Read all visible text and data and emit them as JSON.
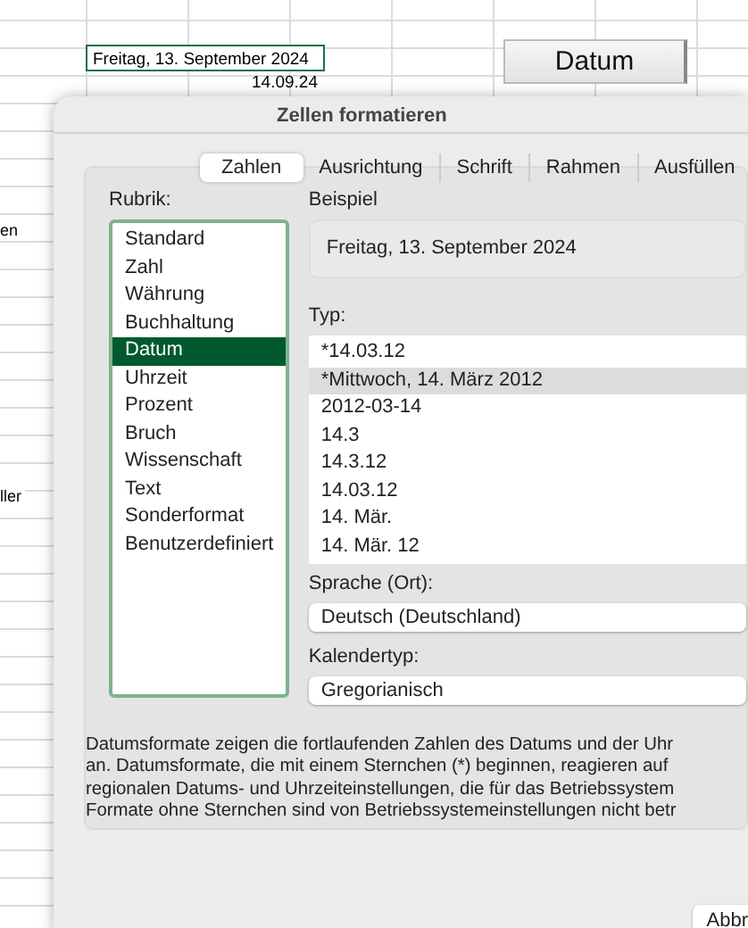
{
  "sheet": {
    "cells": [
      {
        "text": "Freitag, 13. September 2024",
        "selected": true
      },
      {
        "text": "14.09.24",
        "selected": false
      }
    ],
    "side_texts": [
      "en",
      "ller"
    ],
    "button": "Datum"
  },
  "dialog": {
    "title": "Zellen formatieren",
    "tabs": [
      {
        "label": "Zahlen",
        "selected": true
      },
      {
        "label": "Ausrichtung",
        "selected": false
      },
      {
        "label": "Schrift",
        "selected": false
      },
      {
        "label": "Rahmen",
        "selected": false
      },
      {
        "label": "Ausfüllen",
        "selected": false
      }
    ],
    "category_label": "Rubrik:",
    "categories": [
      {
        "label": "Standard",
        "selected": false
      },
      {
        "label": "Zahl",
        "selected": false
      },
      {
        "label": "Währung",
        "selected": false
      },
      {
        "label": "Buchhaltung",
        "selected": false
      },
      {
        "label": "Datum",
        "selected": true
      },
      {
        "label": "Uhrzeit",
        "selected": false
      },
      {
        "label": "Prozent",
        "selected": false
      },
      {
        "label": "Bruch",
        "selected": false
      },
      {
        "label": "Wissenschaft",
        "selected": false
      },
      {
        "label": "Text",
        "selected": false
      },
      {
        "label": "Sonderformat",
        "selected": false
      },
      {
        "label": "Benutzerdefiniert",
        "selected": false
      }
    ],
    "sample_label": "Beispiel",
    "sample": "Freitag, 13. September 2024",
    "type_label": "Typ:",
    "types": [
      {
        "label": "*14.03.12",
        "selected": false
      },
      {
        "label": "*Mittwoch, 14. März 2012",
        "selected": true
      },
      {
        "label": "2012-03-14",
        "selected": false
      },
      {
        "label": "14.3",
        "selected": false
      },
      {
        "label": "14.3.12",
        "selected": false
      },
      {
        "label": "14.03.12",
        "selected": false
      },
      {
        "label": "14. Mär.",
        "selected": false
      },
      {
        "label": "14. Mär. 12",
        "selected": false
      }
    ],
    "locale_label": "Sprache (Ort):",
    "locale": "Deutsch (Deutschland)",
    "calendar_label": "Kalendertyp:",
    "calendar": "Gregorianisch",
    "description": [
      "Datumsformate zeigen die fortlaufenden Zahlen des Datums und der Uhr",
      "an. Datumsformate, die mit einem Sternchen (*) beginnen, reagieren auf",
      "regionalen Datums- und Uhrzeiteinstellungen, die für das Betriebssystem",
      "Formate ohne Sternchen sind von Betriebssystemeinstellungen nicht betr"
    ],
    "buttons": [
      "Abbr"
    ]
  }
}
